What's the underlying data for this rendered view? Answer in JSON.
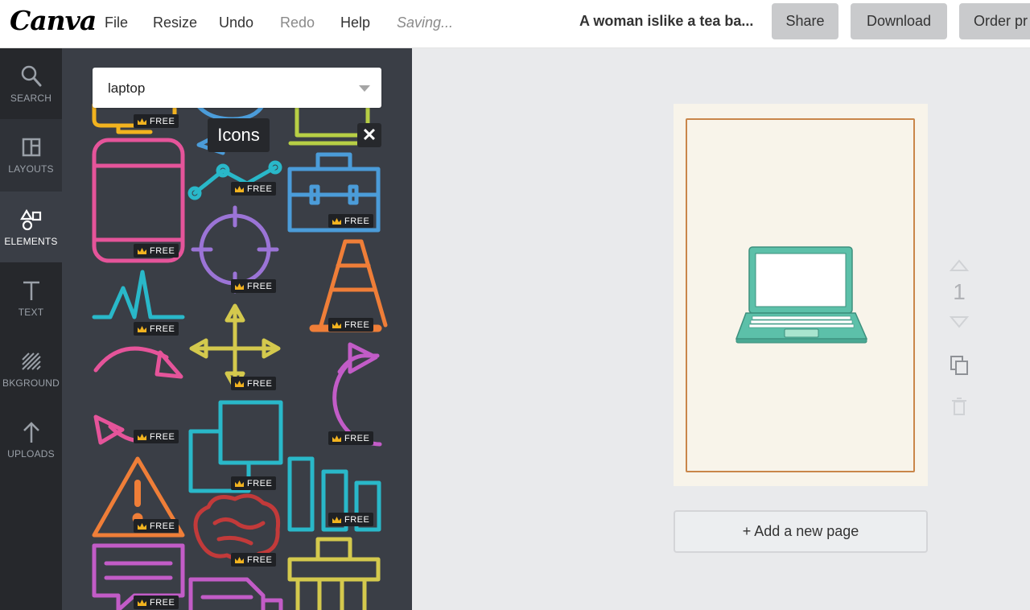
{
  "app": {
    "logo": "Canva"
  },
  "menu": {
    "file": "File",
    "resize": "Resize",
    "undo": "Undo",
    "redo": "Redo",
    "help": "Help",
    "status": "Saving..."
  },
  "document": {
    "title": "A woman islike a tea ba..."
  },
  "toolbar": {
    "share": "Share",
    "download": "Download",
    "order": "Order pr"
  },
  "sidebar": {
    "items": [
      {
        "label": "SEARCH",
        "icon": "search-icon"
      },
      {
        "label": "LAYOUTS",
        "icon": "layout-icon"
      },
      {
        "label": "ELEMENTS",
        "icon": "shapes-icon",
        "active": true
      },
      {
        "label": "TEXT",
        "icon": "text-icon"
      },
      {
        "label": "BKGROUND",
        "icon": "background-icon"
      },
      {
        "label": "UPLOADS",
        "icon": "upload-arrow-icon"
      }
    ]
  },
  "panel": {
    "search": {
      "value": "laptop"
    },
    "tooltip": "Icons",
    "close": "✕",
    "badge_label": "FREE",
    "icons": [
      "desktop-icon",
      "webcam-icon",
      "laptop-outline-icon",
      "smartphone-icon",
      "line-graph-icon",
      "briefcase-icon",
      "crosshair-icon",
      "traffic-cone-icon",
      "heartbeat-icon",
      "move-arrows-icon",
      "circular-arrow-icon",
      "curved-arrow-icon",
      "duplicate-squares-icon",
      "warning-triangle-icon",
      "brain-icon",
      "bar-chart-icon",
      "chat-bubble-icon",
      "document-icon",
      "trash-bin-icon"
    ]
  },
  "canvas": {
    "page_number": "1",
    "add_page": "+ Add a new page",
    "element": "laptop-illustration"
  },
  "colors": {
    "topbar": "#ffffff",
    "sidebar": "#26282c",
    "panel": "#3a3e46",
    "canvas_bg": "#e9eaec",
    "page_bg": "#f8f4ea",
    "page_border": "#c9864a",
    "laptop": "#5cc0a9",
    "crown": "#f2b31f"
  }
}
